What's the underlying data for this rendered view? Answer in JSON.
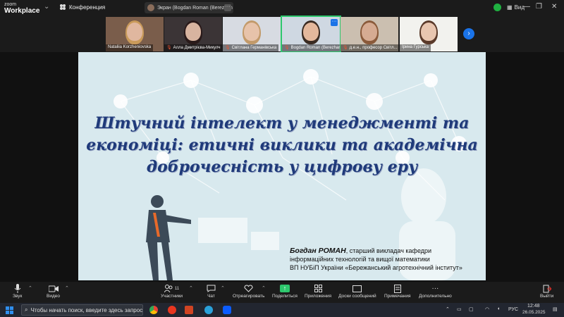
{
  "titlebar": {
    "logo_top": "zoom",
    "logo_bottom": "Workplace",
    "meeting_label": "Конференция",
    "share_label": "Экран (Bogdan Roman (Berezhan",
    "more": "···",
    "view_label": "Вид"
  },
  "participants": [
    {
      "name": "Nataliia Korzheniovska",
      "muted": false,
      "bg": "#7a5d4b",
      "skin": "#e0b79f",
      "hair": "#c99a5a"
    },
    {
      "name": "Алла Дмитрієва-Микулч",
      "muted": true,
      "bg": "#3b3436",
      "skin": "#d8b4a0",
      "hair": "#2a1a1a"
    },
    {
      "name": "Світлана Германівська",
      "muted": true,
      "bg": "#d7dbe2",
      "skin": "#e7c3aa",
      "hair": "#c29a6a"
    },
    {
      "name": "Bogdan Roman (Berezhan...",
      "muted": true,
      "bg": "#cfd8e2",
      "skin": "#e4b89c",
      "hair": "#3a2b22",
      "active": true
    },
    {
      "name": "д.е.н., професор Світл...",
      "muted": true,
      "bg": "#cbbfb0",
      "skin": "#d6ab92",
      "hair": "#8a5a3a"
    },
    {
      "name": "Ірина Гурська",
      "muted": false,
      "bg": "#f2f2ee",
      "skin": "#e8c6b0",
      "hair": "#5a3a2a"
    }
  ],
  "slide": {
    "title_lines": [
      "Штучний інтелект у менеджменті та",
      "економіці: етичні виклики та академічна",
      "доброчесність у цифрову еру"
    ],
    "author_name": "Богдан РОМАН",
    "author_lines": [
      ", старший викладач кафедри",
      "інформаційних технологій та вищої математики",
      "ВП НУБіП України «Бережанський агротехнічний інститут»"
    ]
  },
  "toolbar": {
    "mic": "Звук",
    "video": "Видео",
    "participants": "Участники",
    "participants_count": "11",
    "chat": "Чат",
    "react": "Отреагировать",
    "share": "Поделиться",
    "apps": "Приложения",
    "whiteboards": "Доски сообщений",
    "notes": "Примечания",
    "more": "Дополнительно",
    "leave": "Выйти"
  },
  "taskbar": {
    "search_placeholder": "Чтобы начать поиск, введите здесь запрос",
    "lang": "РУС",
    "time": "12:48",
    "date": "26.05.2025"
  },
  "colors": {
    "accent": "#2dc76d",
    "slide_bg": "#d8e9ee",
    "title_color": "#1f3a7a"
  }
}
